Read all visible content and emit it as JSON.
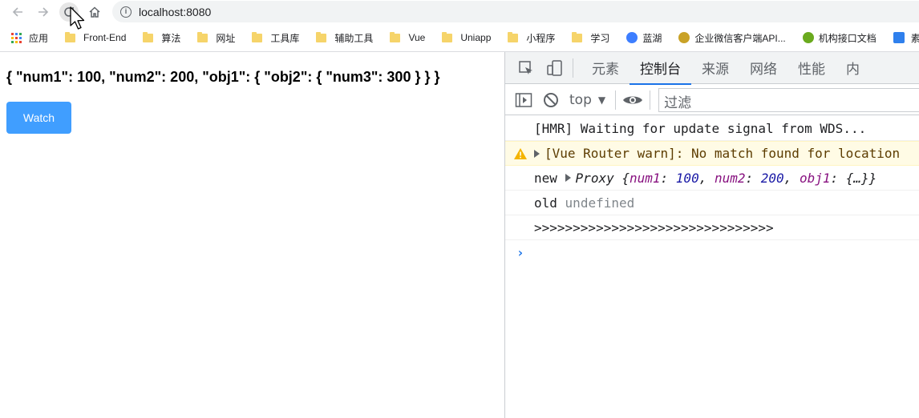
{
  "toolbar": {
    "url": "localhost:8080"
  },
  "bookmarks": [
    {
      "label": "应用",
      "icon": "apps-grid-icon"
    },
    {
      "label": "Front-End",
      "icon": "folder-icon"
    },
    {
      "label": "算法",
      "icon": "folder-icon"
    },
    {
      "label": "网址",
      "icon": "folder-icon"
    },
    {
      "label": "工具库",
      "icon": "folder-icon"
    },
    {
      "label": "辅助工具",
      "icon": "folder-icon"
    },
    {
      "label": "Vue",
      "icon": "folder-icon"
    },
    {
      "label": "Uniapp",
      "icon": "folder-icon"
    },
    {
      "label": "小程序",
      "icon": "folder-icon"
    },
    {
      "label": "学习",
      "icon": "folder-icon"
    },
    {
      "label": "蓝湖",
      "icon": "lanhu-icon"
    },
    {
      "label": "企业微信客户端API...",
      "icon": "wecom-icon"
    },
    {
      "label": "机构接口文档",
      "icon": "api-doc-icon"
    },
    {
      "label": "素材",
      "icon": "material-icon"
    }
  ],
  "page": {
    "json_text": "{ \"num1\": 100, \"num2\": 200, \"obj1\": { \"obj2\": { \"num3\": 300 } } }",
    "watch_button": "Watch"
  },
  "devtools": {
    "tabs": [
      "元素",
      "控制台",
      "来源",
      "网络",
      "性能",
      "内"
    ],
    "active_tab": "控制台",
    "context": "top",
    "filter_placeholder": "过滤",
    "console": {
      "hmr": "[HMR] Waiting for update signal from WDS...",
      "warn": "[Vue Router warn]: No match found for location",
      "new_label": "new",
      "proxy_name": "Proxy",
      "proxy_open": "{",
      "k1": "num1",
      "v1": "100",
      "k2": "num2",
      "v2": "200",
      "k3": "obj1",
      "v3": "{…}",
      "proxy_close": "}",
      "old_label": "old",
      "old_value": "undefined",
      "arrows": ">>>>>>>>>>>>>>>>>>>>>>>>>>>>>>>",
      "prompt": "›"
    }
  },
  "colors": {
    "accent": "#409eff",
    "devtools_active": "#1a73e8",
    "warn_bg": "#fffbe5"
  }
}
